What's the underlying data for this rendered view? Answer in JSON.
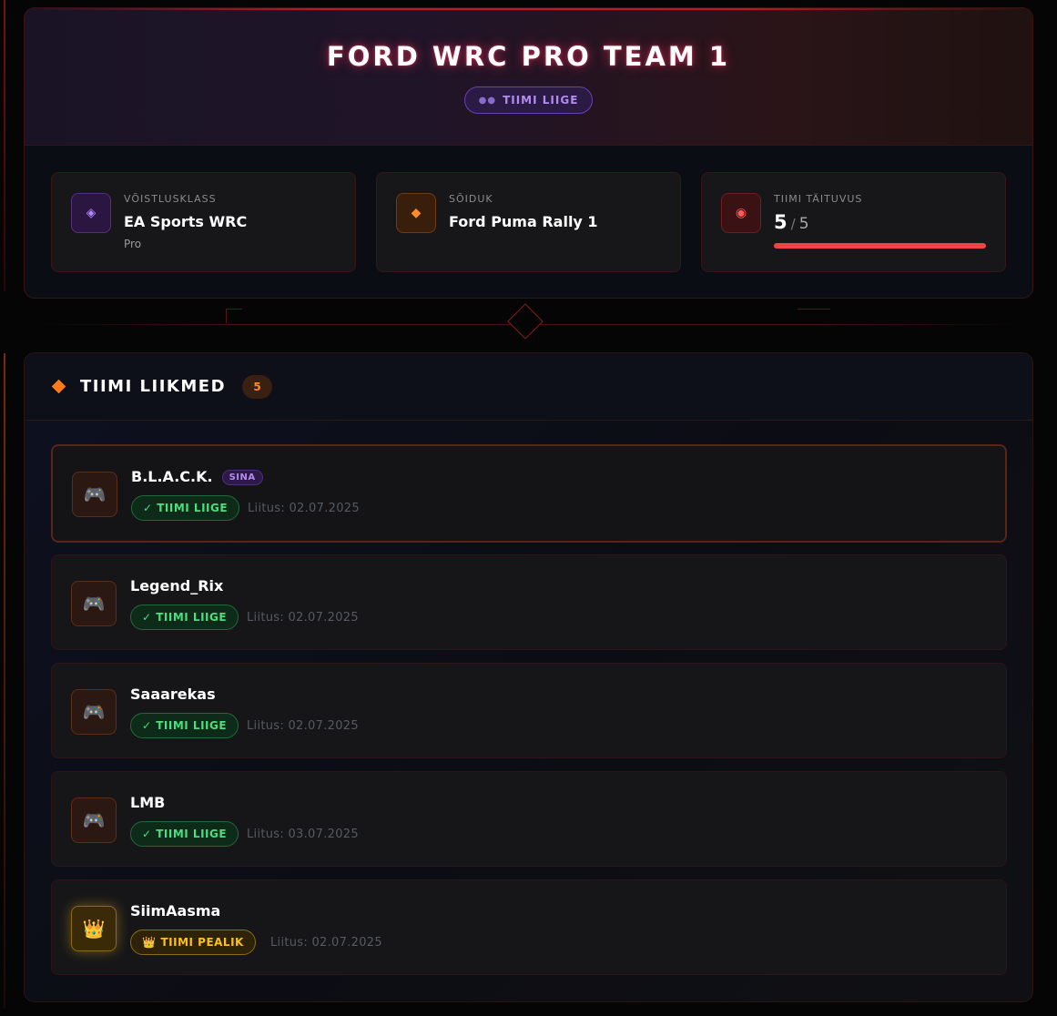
{
  "team": {
    "name": "FORD WRC PRO TEAM 1",
    "role_badge": "TIIMI LIIGE",
    "info": {
      "class_label": "VÕISTLUSKLASS",
      "class_value": "EA Sports WRC",
      "class_sub": "Pro",
      "vehicle_label": "SÕIDUK",
      "vehicle_value": "Ford Puma Rally 1",
      "fill_label": "TIIMI TÄITUVUS",
      "fill_current": "5",
      "fill_sep": "/",
      "fill_max": "5",
      "fill_fraction": 1.0
    }
  },
  "members_section": {
    "title": "TIIMI LIIKMED",
    "count": "5",
    "you_label": "SINA",
    "members": [
      {
        "name": "B.L.A.C.K.",
        "role": "✓ TIIMI LIIGE",
        "joined": "Liitus: 02.07.2025"
      },
      {
        "name": "Legend_Rix",
        "role": "✓ TIIMI LIIGE",
        "joined": "Liitus: 02.07.2025"
      },
      {
        "name": "Saaarekas",
        "role": "✓ TIIMI LIIGE",
        "joined": "Liitus: 02.07.2025"
      },
      {
        "name": "LMB",
        "role": "✓ TIIMI LIIGE",
        "joined": "Liitus: 03.07.2025"
      },
      {
        "name": "SiimAasma",
        "role": "TIIMI PEALIK",
        "joined": "Liitus: 02.07.2025"
      }
    ]
  },
  "colors": {
    "accent_red": "#ef4444",
    "accent_orange": "#ff7a1a",
    "member_green": "#4ade80",
    "leader_gold": "#fbbf24",
    "you_purple": "#b48cf0"
  },
  "icons": {
    "team_member": "users-icon",
    "class": "diamond-icon",
    "vehicle": "diamond-icon",
    "fill": "target-icon",
    "member_avatar": "gamepad-icon",
    "leader_avatar": "crown-icon"
  }
}
